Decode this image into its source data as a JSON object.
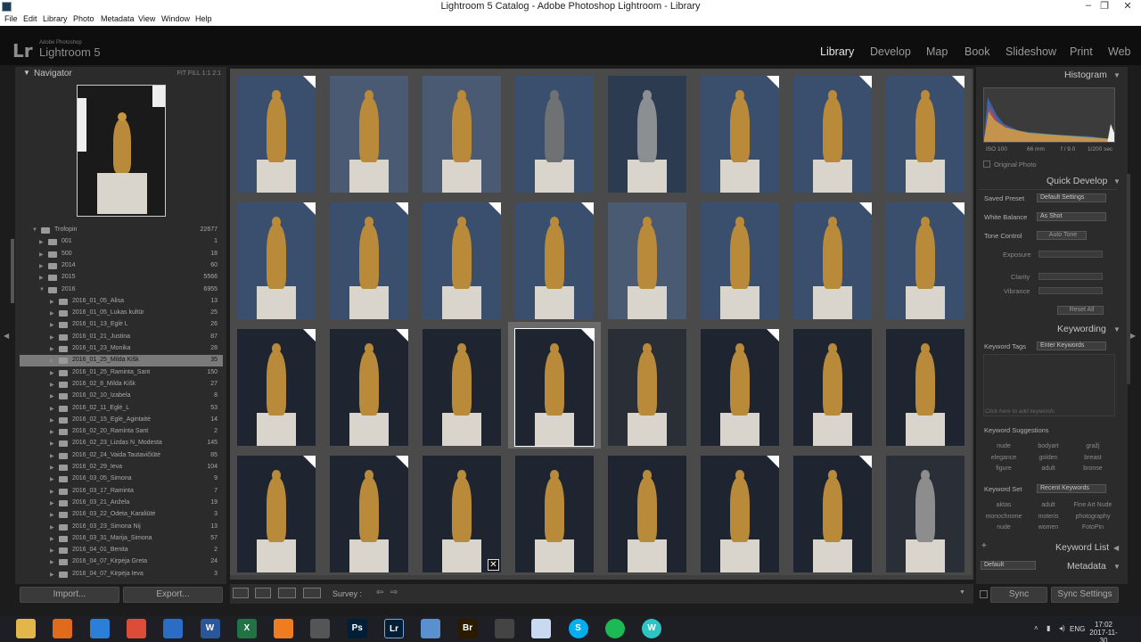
{
  "window": {
    "title": "Lightroom 5 Catalog - Adobe Photoshop Lightroom - Library"
  },
  "menu": [
    "File",
    "Edit",
    "Library",
    "Photo",
    "Metadata",
    "View",
    "Window",
    "Help"
  ],
  "identity": {
    "logo": "Lr",
    "adobe": "Adobe Photoshop",
    "product": "Lightroom 5"
  },
  "modules": [
    "Library",
    "Develop",
    "Map",
    "Book",
    "Slideshow",
    "Print",
    "Web"
  ],
  "navigator": {
    "title": "Navigator",
    "zoom": "FIT  FILL  1:1  2:1"
  },
  "folders": [
    {
      "name": "Trofopin",
      "count": "22677",
      "level": 0,
      "open": true
    },
    {
      "name": "001",
      "count": "1",
      "level": 1
    },
    {
      "name": "500",
      "count": "18",
      "level": 1
    },
    {
      "name": "2014",
      "count": "60",
      "level": 1
    },
    {
      "name": "2015",
      "count": "5566",
      "level": 1
    },
    {
      "name": "2016",
      "count": "6955",
      "level": 1,
      "open": true
    },
    {
      "name": "2016_01_05_Alisa",
      "count": "13",
      "level": 2
    },
    {
      "name": "2016_01_05_Lukas kultūr",
      "count": "25",
      "level": 2
    },
    {
      "name": "2016_01_13_Eglė L",
      "count": "26",
      "level": 2
    },
    {
      "name": "2016_01_21_Justina",
      "count": "87",
      "level": 2
    },
    {
      "name": "2016_01_23_Monika",
      "count": "28",
      "level": 2
    },
    {
      "name": "2016_01_25_Milda Kišk",
      "count": "35",
      "level": 2,
      "selected": true
    },
    {
      "name": "2016_01_25_Raminta_Sant",
      "count": "150",
      "level": 2
    },
    {
      "name": "2016_02_8_Milda Kišk",
      "count": "27",
      "level": 2
    },
    {
      "name": "2016_02_10_Izabela",
      "count": "8",
      "level": 2
    },
    {
      "name": "2016_02_11_Eglė_L",
      "count": "53",
      "level": 2
    },
    {
      "name": "2016_02_15_Eglė_Agintaitė",
      "count": "14",
      "level": 2
    },
    {
      "name": "2016_02_20_Raminta Sant",
      "count": "2",
      "level": 2
    },
    {
      "name": "2016_02_23_Lizdas N_Modesta",
      "count": "145",
      "level": 2
    },
    {
      "name": "2016_02_24_Vaida Tautavičiūtė",
      "count": "85",
      "level": 2
    },
    {
      "name": "2016_02_29_Ieva",
      "count": "104",
      "level": 2
    },
    {
      "name": "2016_03_05_Simona",
      "count": "9",
      "level": 2
    },
    {
      "name": "2016_03_17_Raminta",
      "count": "7",
      "level": 2
    },
    {
      "name": "2016_03_21_Anželа",
      "count": "19",
      "level": 2
    },
    {
      "name": "2016_03_22_Odeta_Karaliūtė",
      "count": "3",
      "level": 2
    },
    {
      "name": "2016_03_23_Simona Nij",
      "count": "13",
      "level": 2
    },
    {
      "name": "2016_03_31_Marija_Simona",
      "count": "57",
      "level": 2
    },
    {
      "name": "2016_04_01_Benita",
      "count": "2",
      "level": 2
    },
    {
      "name": "2016_04_07_Kirpėja Greta",
      "count": "24",
      "level": 2
    },
    {
      "name": "2016_04_07_Kirpėja Ieva",
      "count": "3",
      "level": 2
    }
  ],
  "left_buttons": {
    "import": "Import...",
    "export": "Export..."
  },
  "toolbar": {
    "survey": "Survey :"
  },
  "histogram": {
    "title": "Histogram",
    "iso": "ISO 100",
    "focal": "66 mm",
    "aperture": "f / 9.0",
    "shutter": "1/200 sec",
    "original": "Original Photo"
  },
  "quick_develop": {
    "title": "Quick Develop",
    "saved_preset_label": "Saved Preset",
    "saved_preset": "Default Settings",
    "white_balance_label": "White Balance",
    "white_balance": "As Shot",
    "tone_control_label": "Tone Control",
    "auto_tone": "Auto Tone",
    "exposure": "Exposure",
    "clarity": "Clarity",
    "vibrance": "Vibrance",
    "reset": "Reset All"
  },
  "keywording": {
    "title": "Keywording",
    "tags_label": "Keyword Tags",
    "tags_value": "Enter Keywords",
    "placeholder": "Click here to add keywords",
    "suggestions_label": "Keyword Suggestions",
    "suggestions": [
      "nude",
      "bodyart",
      "gražį",
      "elegance",
      "golden",
      "breast",
      "figure",
      "adult",
      "bronse"
    ],
    "set_label": "Keyword Set",
    "set_value": "Recent Keywords",
    "set": [
      "aktas",
      "adult",
      "Fine Art Nude",
      "monochrome",
      "moteris",
      "photography",
      "nude",
      "women",
      "FotoPin"
    ]
  },
  "keyword_list": {
    "title": "Keyword List"
  },
  "metadata": {
    "title": "Metadata",
    "preset": "Default"
  },
  "sync": {
    "sync": "Sync",
    "sync_settings": "Sync Settings"
  },
  "thumbs": [
    [
      {
        "bg": "#3a4f6e",
        "fig": "#b98a3a",
        "corner": true
      },
      {
        "bg": "#4a5a73",
        "fig": "#b98a3a",
        "corner": false
      },
      {
        "bg": "#4a5a73",
        "fig": "#b98a3a",
        "corner": false
      },
      {
        "bg": "#3a4f6e",
        "fig": "#6f7275",
        "corner": false
      },
      {
        "bg": "#2d3b50",
        "fig": "#8c8f92",
        "corner": false
      },
      {
        "bg": "#3a4f6e",
        "fig": "#b98a3a",
        "corner": true
      },
      {
        "bg": "#3a4f6e",
        "fig": "#b98a3a",
        "corner": true
      },
      {
        "bg": "#3a4f6e",
        "fig": "#b98a3a",
        "corner": true
      }
    ],
    [
      {
        "bg": "#3a4f6e",
        "fig": "#b98a3a",
        "corner": true
      },
      {
        "bg": "#3a4f6e",
        "fig": "#b98a3a",
        "corner": true
      },
      {
        "bg": "#3a4f6e",
        "fig": "#b98a3a",
        "corner": true
      },
      {
        "bg": "#3a4f6e",
        "fig": "#b98a3a",
        "corner": true
      },
      {
        "bg": "#4a5a73",
        "fig": "#b98a3a",
        "corner": false
      },
      {
        "bg": "#3a4f6e",
        "fig": "#b98a3a",
        "corner": false
      },
      {
        "bg": "#3a4f6e",
        "fig": "#b98a3a",
        "corner": true
      },
      {
        "bg": "#3a4f6e",
        "fig": "#b98a3a",
        "corner": true
      }
    ],
    [
      {
        "bg": "#1f2530",
        "fig": "#b98a3a",
        "corner": true
      },
      {
        "bg": "#1f2530",
        "fig": "#b98a3a",
        "corner": true
      },
      {
        "bg": "#1f2530",
        "fig": "#b98a3a",
        "corner": false
      },
      {
        "bg": "#1f2530",
        "fig": "#b98a3a",
        "corner": true
      },
      {
        "bg": "#2a2e36",
        "fig": "#b98a3a",
        "corner": false
      },
      {
        "bg": "#1f2530",
        "fig": "#b98a3a",
        "corner": true
      },
      {
        "bg": "#1f2530",
        "fig": "#b98a3a",
        "corner": false
      },
      {
        "bg": "#1f2530",
        "fig": "#b98a3a",
        "corner": false
      }
    ],
    [
      {
        "bg": "#1f2530",
        "fig": "#b98a3a",
        "corner": true
      },
      {
        "bg": "#1f2530",
        "fig": "#b98a3a",
        "corner": true
      },
      {
        "bg": "#1f2530",
        "fig": "#b98a3a",
        "corner": false
      },
      {
        "bg": "#1f2530",
        "fig": "#b98a3a",
        "corner": false
      },
      {
        "bg": "#1f2530",
        "fig": "#b98a3a",
        "corner": false
      },
      {
        "bg": "#1f2530",
        "fig": "#b98a3a",
        "corner": true
      },
      {
        "bg": "#1f2530",
        "fig": "#b98a3a",
        "corner": true
      },
      {
        "bg": "#2a2e36",
        "fig": "#8d8d8d",
        "corner": false
      }
    ]
  ],
  "selected_thumb": {
    "row": 2,
    "col": 3
  },
  "taskbar": {
    "icons": [
      "file-explorer-icon",
      "firefox-icon",
      "edge-icon",
      "chrome-icon",
      "skype-for-business-icon",
      "word-icon",
      "excel-icon",
      "avast-icon",
      "camera-icon",
      "photoshop-icon",
      "lightroom-icon",
      "pinwheel-icon",
      "bridge-icon",
      "app-icon",
      "document-icon",
      "skype-icon",
      "spotify-icon",
      "w-icon"
    ],
    "lang": "ENG",
    "time": "17:02",
    "date": "2017-11-30"
  }
}
